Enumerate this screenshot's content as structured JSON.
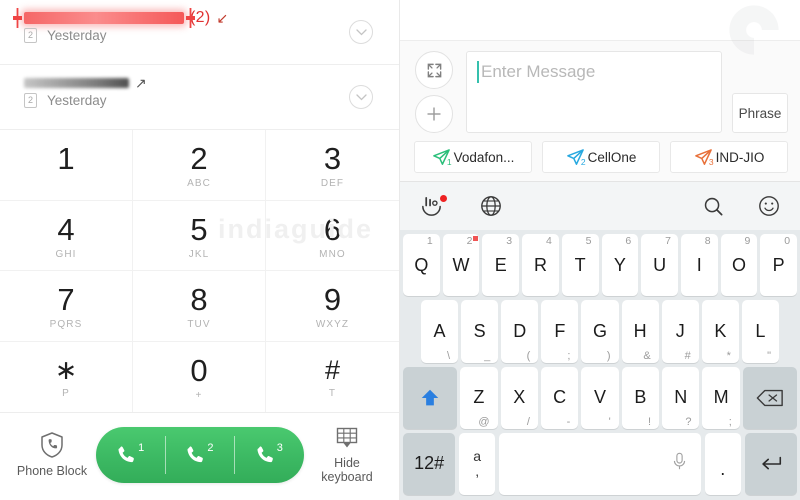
{
  "call_log": {
    "entries": [
      {
        "redacted": true,
        "redact_color": "red",
        "count_label": "(2)",
        "direction": "incoming",
        "sim_badge": "2",
        "time": "Yesterday"
      },
      {
        "redacted": true,
        "redact_color": "gray",
        "count_label": "",
        "direction": "outgoing",
        "sim_badge": "2",
        "time": "Yesterday"
      }
    ]
  },
  "dialpad": {
    "keys": [
      {
        "digit": "1",
        "letters": ""
      },
      {
        "digit": "2",
        "letters": "ABC"
      },
      {
        "digit": "3",
        "letters": "DEF"
      },
      {
        "digit": "4",
        "letters": "GHI"
      },
      {
        "digit": "5",
        "letters": "JKL"
      },
      {
        "digit": "6",
        "letters": "MNO"
      },
      {
        "digit": "7",
        "letters": "PQRS"
      },
      {
        "digit": "8",
        "letters": "TUV"
      },
      {
        "digit": "9",
        "letters": "WXYZ"
      },
      {
        "digit": "∗",
        "letters": "P"
      },
      {
        "digit": "0",
        "letters": "+"
      },
      {
        "digit": "#",
        "letters": "T"
      }
    ]
  },
  "bottom_bar": {
    "phone_block_label": "Phone Block",
    "hide_keyboard_label": "Hide\nkeyboard",
    "hide_keyboard_line1": "Hide",
    "hide_keyboard_line2": "keyboard",
    "call_buttons": [
      {
        "index": "1"
      },
      {
        "index": "2"
      },
      {
        "index": "3"
      }
    ],
    "call_pill_color": "#3cb963"
  },
  "watermark": {
    "text": "indiaguide",
    "logo": "C"
  },
  "compose": {
    "placeholder": "Enter Message",
    "value": "",
    "phrase_label": "Phrase",
    "expand_icon": "expand-icon",
    "add_icon": "plus-icon",
    "sim_buttons": [
      {
        "label": "Vodafon...",
        "index": "1",
        "color": "#2bbf7a"
      },
      {
        "label": "CellOne",
        "index": "2",
        "color": "#28a9e0"
      },
      {
        "label": "IND-JIO",
        "index": "3",
        "color": "#e8713a"
      }
    ]
  },
  "keyboard": {
    "toolbar": [
      {
        "name": "handwriting-icon",
        "badge": true
      },
      {
        "name": "globe-icon",
        "badge": false
      },
      {
        "name": "search-icon",
        "badge": false
      },
      {
        "name": "emoji-icon",
        "badge": false
      }
    ],
    "row1": [
      {
        "main": "Q",
        "alt": "1",
        "dot": false
      },
      {
        "main": "W",
        "alt": "2",
        "dot": true
      },
      {
        "main": "E",
        "alt": "3",
        "dot": false
      },
      {
        "main": "R",
        "alt": "4",
        "dot": false
      },
      {
        "main": "T",
        "alt": "5",
        "dot": false
      },
      {
        "main": "Y",
        "alt": "6",
        "dot": false
      },
      {
        "main": "U",
        "alt": "7",
        "dot": false
      },
      {
        "main": "I",
        "alt": "8",
        "dot": false
      },
      {
        "main": "O",
        "alt": "9",
        "dot": false
      },
      {
        "main": "P",
        "alt": "0",
        "dot": false
      }
    ],
    "row2": [
      {
        "main": "A",
        "alt": "\\"
      },
      {
        "main": "S",
        "alt": "_"
      },
      {
        "main": "D",
        "alt": "("
      },
      {
        "main": "F",
        "alt": ";"
      },
      {
        "main": "G",
        "alt": ")"
      },
      {
        "main": "H",
        "alt": "&"
      },
      {
        "main": "J",
        "alt": "#"
      },
      {
        "main": "K",
        "alt": "*"
      },
      {
        "main": "L",
        "alt": "\""
      }
    ],
    "row3": [
      {
        "main": "Z",
        "alt": "@"
      },
      {
        "main": "X",
        "alt": "/"
      },
      {
        "main": "C",
        "alt": "-"
      },
      {
        "main": "V",
        "alt": "'"
      },
      {
        "main": "B",
        "alt": "!"
      },
      {
        "main": "N",
        "alt": "?"
      },
      {
        "main": "M",
        "alt": ";"
      }
    ],
    "shift_key": "shift-icon",
    "backspace_key": "backspace-icon",
    "symbols_key": "12#",
    "lang_key_top": "a",
    "lang_key_bottom": ",",
    "space_key": "",
    "period_key": ".",
    "enter_key": "enter-icon"
  }
}
